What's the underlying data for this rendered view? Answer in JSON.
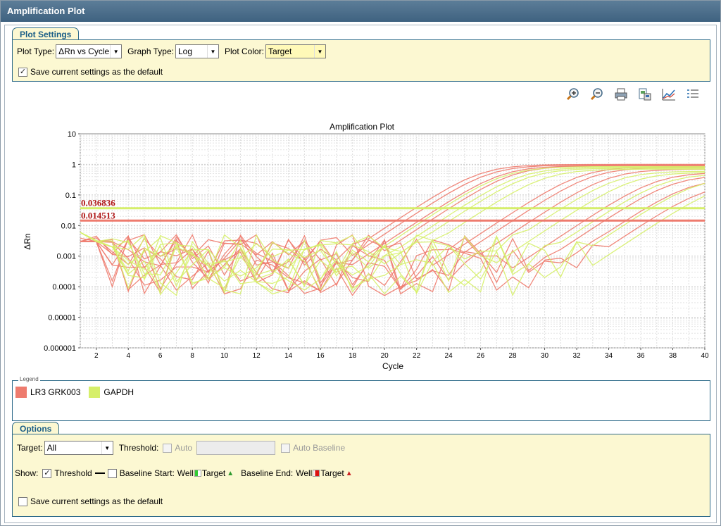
{
  "window": {
    "title": "Amplification Plot"
  },
  "plot_settings": {
    "tab_label": "Plot Settings",
    "plot_type_label": "Plot Type:",
    "plot_type_value": "ΔRn vs Cycle",
    "graph_type_label": "Graph Type:",
    "graph_type_value": "Log",
    "plot_color_label": "Plot Color:",
    "plot_color_value": "Target",
    "save_default_label": "Save current settings as the default",
    "save_default_checked": true
  },
  "toolbar": {
    "icons": [
      "zoom-in-icon",
      "zoom-out-icon",
      "print-icon",
      "export-icon",
      "line-chart-icon",
      "list-icon"
    ]
  },
  "legend": {
    "title": "Legend",
    "items": [
      {
        "label": "LR3 GRK003",
        "color": "#ee7b6e"
      },
      {
        "label": "GAPDH",
        "color": "#d6ef6a"
      }
    ]
  },
  "options": {
    "tab_label": "Options",
    "target_label": "Target:",
    "target_value": "All",
    "threshold_label": "Threshold:",
    "auto_label": "Auto",
    "auto_baseline_label": "Auto Baseline",
    "show_label": "Show:",
    "threshold_show_label": "Threshold",
    "baseline_start_label": "Baseline Start:",
    "well_label_1": "Well",
    "target_label_1": "Target",
    "baseline_end_label": "Baseline End:",
    "well_label_2": "Well",
    "target_label_2": "Target",
    "save_default_label": "Save current settings as the default"
  },
  "chart_data": {
    "type": "line",
    "title": "Amplification Plot",
    "xlabel": "Cycle",
    "ylabel": "ΔRn",
    "xlim": [
      1,
      40
    ],
    "ylim": [
      1e-06,
      10
    ],
    "yscale": "log",
    "x_ticks": [
      2,
      4,
      6,
      8,
      10,
      12,
      14,
      16,
      18,
      20,
      22,
      24,
      26,
      28,
      30,
      32,
      34,
      36,
      38,
      40
    ],
    "y_ticks": [
      "10",
      "1",
      "0.1",
      "0.01",
      "0.001",
      "0.0001",
      "0.00001",
      "0.000001"
    ],
    "y_tick_values": [
      10,
      1,
      0.1,
      0.01,
      0.001,
      0.0001,
      1e-05,
      1e-06
    ],
    "grid": true,
    "thresholds": [
      {
        "label": "0.036836",
        "value": 0.036836,
        "color": "#d6ef6a"
      },
      {
        "label": "0.014513",
        "value": 0.014513,
        "color": "#ee7b6e"
      }
    ],
    "label_color": "#b01818",
    "series": [
      {
        "name": "LR3 GRK003",
        "color": "#ee7b6e",
        "curves": [
          {
            "ct": 21.5,
            "plateau": 1.0
          },
          {
            "ct": 22.0,
            "plateau": 0.95
          },
          {
            "ct": 22.8,
            "plateau": 0.9
          },
          {
            "ct": 23.5,
            "plateau": 0.9
          },
          {
            "ct": 27.8,
            "plateau": 0.85
          },
          {
            "ct": 28.5,
            "plateau": 0.8
          },
          {
            "ct": 29.5,
            "plateau": 0.7
          },
          {
            "ct": 32.5,
            "plateau": 0.55
          },
          {
            "ct": 33.5,
            "plateau": 0.45
          },
          {
            "ct": 34.5,
            "plateau": 0.35
          },
          {
            "ct": 35.5,
            "plateau": 0.25
          }
        ]
      },
      {
        "name": "GAPDH",
        "color": "#d6ef6a",
        "curves": [
          {
            "ct": 23.0,
            "plateau": 0.85
          },
          {
            "ct": 24.0,
            "plateau": 0.8
          },
          {
            "ct": 24.5,
            "plateau": 0.75
          },
          {
            "ct": 25.5,
            "plateau": 0.7
          },
          {
            "ct": 30.0,
            "plateau": 0.6
          },
          {
            "ct": 31.0,
            "plateau": 0.55
          },
          {
            "ct": 33.0,
            "plateau": 0.5
          },
          {
            "ct": 35.0,
            "plateau": 0.4
          },
          {
            "ct": 36.5,
            "plateau": 0.3
          }
        ]
      }
    ]
  }
}
